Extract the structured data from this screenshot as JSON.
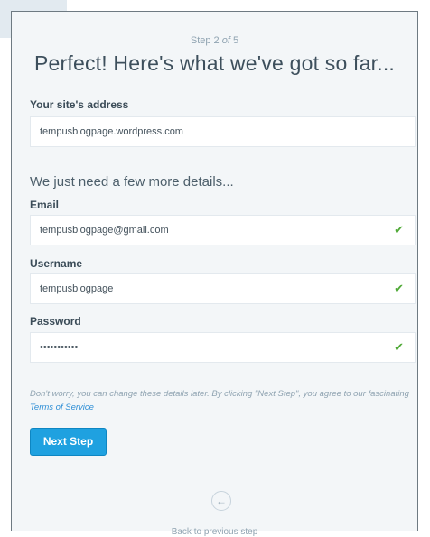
{
  "step": {
    "prefix": "Step 2 ",
    "of": "of",
    "suffix": " 5"
  },
  "title": "Perfect! Here's what we've got so far...",
  "site": {
    "label": "Your site's address",
    "value": "tempusblogpage.wordpress.com"
  },
  "subheading": "We just need a few more details...",
  "email": {
    "label": "Email",
    "value": "tempusblogpage@gmail.com",
    "valid": true
  },
  "username": {
    "label": "Username",
    "value": "tempusblogpage",
    "valid": true
  },
  "password": {
    "label": "Password",
    "value": "•••••••••••",
    "valid": true
  },
  "note": {
    "text": "Don't worry, you can change these details later. By clicking \"Next Step\", you agree to our fascinating ",
    "link": "Terms of Service"
  },
  "next_button": "Next Step",
  "back": {
    "icon": "left-arrow-icon",
    "label": "Back to previous step"
  },
  "colors": {
    "accent": "#1fa1e0",
    "valid": "#4fa936",
    "background": "#f3f6f8"
  }
}
